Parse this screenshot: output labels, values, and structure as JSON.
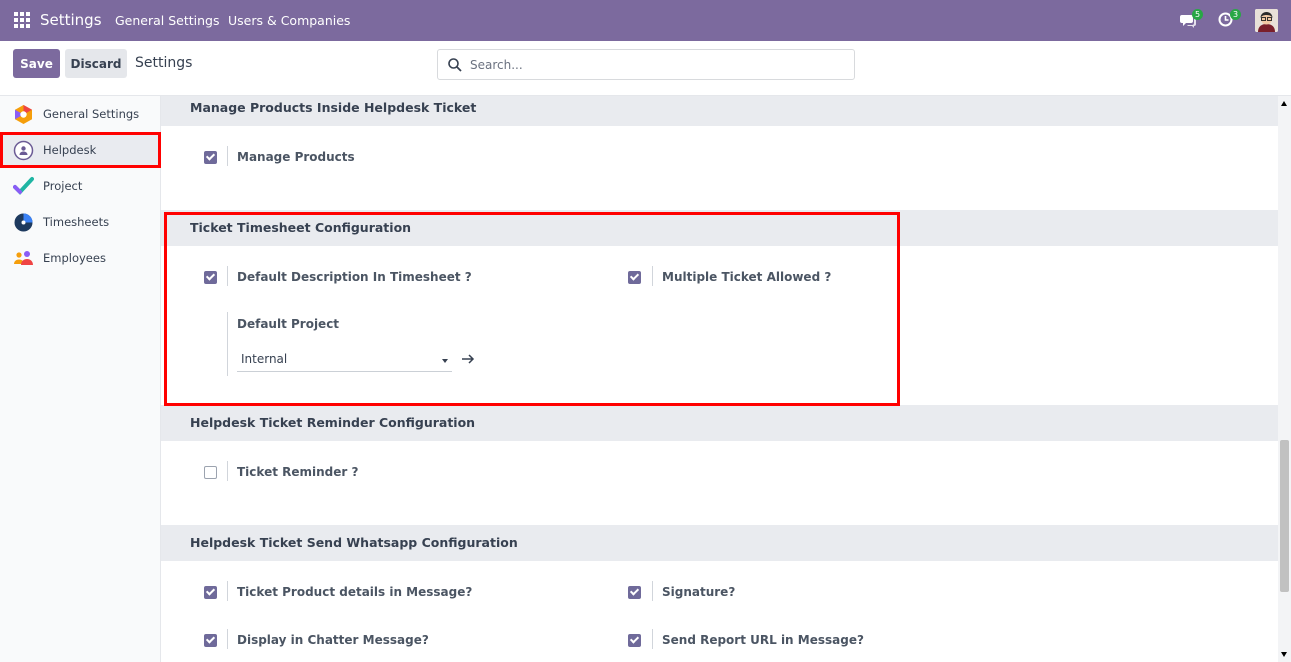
{
  "navbar": {
    "brand": "Settings",
    "links": [
      "General Settings",
      "Users & Companies"
    ],
    "chat_count": "5",
    "activity_count": "3"
  },
  "control_panel": {
    "save_label": "Save",
    "discard_label": "Discard",
    "title": "Settings",
    "search_placeholder": "Search..."
  },
  "sidebar": {
    "items": [
      {
        "label": "General Settings",
        "icon": "general-settings-icon",
        "active": false
      },
      {
        "label": "Helpdesk",
        "icon": "helpdesk-icon",
        "active": true
      },
      {
        "label": "Project",
        "icon": "project-icon",
        "active": false
      },
      {
        "label": "Timesheets",
        "icon": "timesheets-icon",
        "active": false
      },
      {
        "label": "Employees",
        "icon": "employees-icon",
        "active": false
      }
    ]
  },
  "sections": {
    "manage_products": {
      "title": "Manage Products Inside Helpdesk Ticket",
      "manage_products": {
        "label": "Manage Products",
        "checked": true
      }
    },
    "timesheet": {
      "title": "Ticket Timesheet Configuration",
      "default_description": {
        "label": "Default Description In Timesheet ?",
        "checked": true
      },
      "multiple_ticket": {
        "label": "Multiple Ticket Allowed ?",
        "checked": true
      },
      "default_project_label": "Default Project",
      "default_project_value": "Internal"
    },
    "reminder": {
      "title": "Helpdesk Ticket Reminder Configuration",
      "ticket_reminder": {
        "label": "Ticket Reminder ?",
        "checked": false
      }
    },
    "whatsapp": {
      "title": "Helpdesk Ticket Send Whatsapp Configuration",
      "product_details": {
        "label": "Ticket Product details in Message?",
        "checked": true
      },
      "signature": {
        "label": "Signature?",
        "checked": true
      },
      "chatter": {
        "label": "Display in Chatter Message?",
        "checked": true
      },
      "report_url": {
        "label": "Send Report URL in Message?",
        "checked": true
      }
    }
  },
  "colors": {
    "navbar": "#7c6a9e",
    "primary": "#7c6a9e",
    "checkbox": "#6f6a9a",
    "highlight": "#ff0000"
  }
}
